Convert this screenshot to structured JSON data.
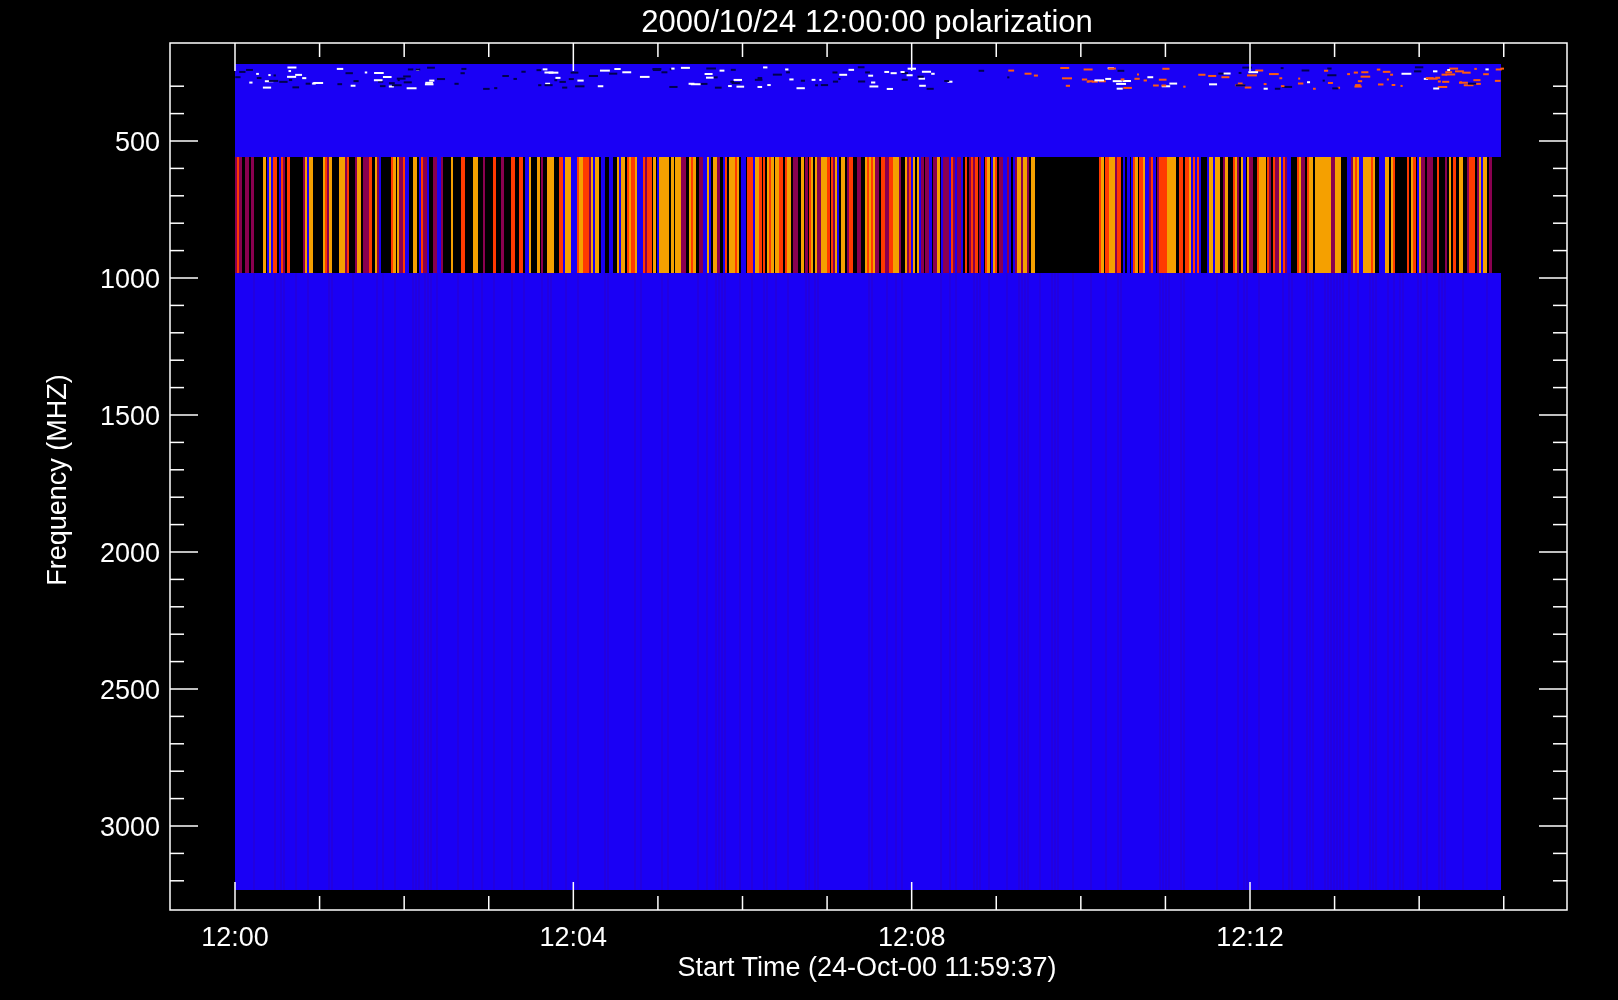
{
  "title": "2000/10/24 12:00:00 polarization",
  "y_axis": {
    "label": "Frequency (MHZ)",
    "ticks": [
      "500",
      "1000",
      "1500",
      "2000",
      "2500",
      "3000"
    ]
  },
  "x_axis": {
    "label": "Start Time (24-Oct-00 11:59:37)",
    "ticks": [
      "12:00",
      "12:04",
      "12:08",
      "12:12"
    ]
  }
}
